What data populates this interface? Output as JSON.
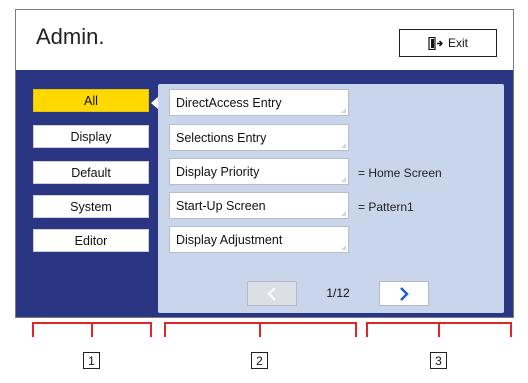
{
  "header": {
    "title": "Admin.",
    "exit_label": "Exit",
    "exit_icon": "exit-door-icon"
  },
  "sidebar": {
    "categories": [
      {
        "label": "All",
        "selected": true
      },
      {
        "label": "Display",
        "selected": false
      },
      {
        "label": "Default",
        "selected": false
      },
      {
        "label": "System",
        "selected": false
      },
      {
        "label": "Editor",
        "selected": false
      }
    ]
  },
  "panel": {
    "items": [
      {
        "label": "DirectAccess Entry",
        "value": ""
      },
      {
        "label": "Selections Entry",
        "value": ""
      },
      {
        "label": "Display Priority",
        "value": "= Home Screen"
      },
      {
        "label": "Start-Up Screen",
        "value": "= Pattern1"
      },
      {
        "label": "Display Adjustment",
        "value": ""
      }
    ],
    "pager": {
      "text": "1/12",
      "prev_icon": "chevron-left-icon",
      "next_icon": "chevron-right-icon",
      "prev_enabled": false
    }
  },
  "callouts": [
    "1",
    "2",
    "3"
  ],
  "colors": {
    "screen_background": "#2a3584",
    "panel_background": "#c9d5ea",
    "selected_category": "#ffd800",
    "next_arrow": "#1e5bd6",
    "callout_bracket": "#e0262b"
  }
}
